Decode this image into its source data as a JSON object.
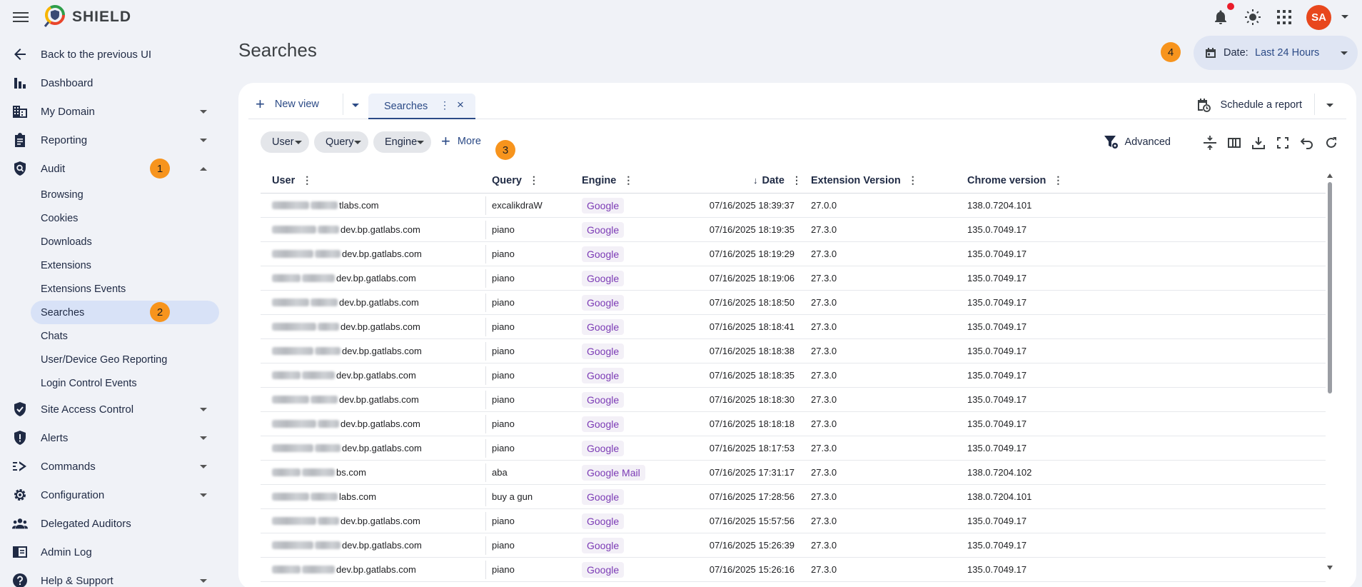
{
  "app": {
    "brand": "SHIELD"
  },
  "topbar": {
    "avatar_initials": "SA"
  },
  "sidebar": {
    "back": "Back to the previous UI",
    "items": [
      {
        "label": "Dashboard",
        "icon": "bar-chart-icon"
      },
      {
        "label": "My Domain",
        "icon": "domain-icon"
      },
      {
        "label": "Reporting",
        "icon": "clipboard-icon"
      },
      {
        "label": "Audit",
        "icon": "audit-shield-icon"
      },
      {
        "label": "Site Access Control",
        "icon": "site-access-icon"
      },
      {
        "label": "Alerts",
        "icon": "alert-shield-icon"
      },
      {
        "label": "Commands",
        "icon": "commands-icon"
      },
      {
        "label": "Configuration",
        "icon": "gear-icon"
      },
      {
        "label": "Delegated Auditors",
        "icon": "people-icon"
      },
      {
        "label": "Admin Log",
        "icon": "log-icon"
      },
      {
        "label": "Help & Support",
        "icon": "help-icon"
      }
    ],
    "audit_sub": [
      "Browsing",
      "Cookies",
      "Downloads",
      "Extensions",
      "Extensions Events",
      "Searches",
      "Chats",
      "User/Device Geo Reporting",
      "Login Control Events"
    ],
    "badges": {
      "audit": "1",
      "searches": "2"
    }
  },
  "main": {
    "title": "Searches",
    "badge_filters": "3",
    "badge_date": "4",
    "date": {
      "label": "Date:",
      "value": "Last 24 Hours"
    },
    "tabs": {
      "new_view": "New view",
      "active": "Searches"
    },
    "schedule": "Schedule a report",
    "filters": [
      "User",
      "Query",
      "Engine"
    ],
    "more": "More",
    "advanced": "Advanced"
  },
  "table": {
    "columns": [
      "User",
      "Query",
      "Engine",
      "Date",
      "Extension Version",
      "Chrome version"
    ],
    "rows": [
      {
        "user": "tlabs.com",
        "query": "excalikdraW",
        "engine": "Google",
        "date": "07/16/2025 18:39:37",
        "ext": "27.0.0",
        "chrome": "138.0.7204.101"
      },
      {
        "user": "dev.bp.gatlabs.com",
        "query": "piano",
        "engine": "Google",
        "date": "07/16/2025 18:19:35",
        "ext": "27.3.0",
        "chrome": "135.0.7049.17"
      },
      {
        "user": "dev.bp.gatlabs.com",
        "query": "piano",
        "engine": "Google",
        "date": "07/16/2025 18:19:29",
        "ext": "27.3.0",
        "chrome": "135.0.7049.17"
      },
      {
        "user": "dev.bp.gatlabs.com",
        "query": "piano",
        "engine": "Google",
        "date": "07/16/2025 18:19:06",
        "ext": "27.3.0",
        "chrome": "135.0.7049.17"
      },
      {
        "user": "dev.bp.gatlabs.com",
        "query": "piano",
        "engine": "Google",
        "date": "07/16/2025 18:18:50",
        "ext": "27.3.0",
        "chrome": "135.0.7049.17"
      },
      {
        "user": "dev.bp.gatlabs.com",
        "query": "piano",
        "engine": "Google",
        "date": "07/16/2025 18:18:41",
        "ext": "27.3.0",
        "chrome": "135.0.7049.17"
      },
      {
        "user": "dev.bp.gatlabs.com",
        "query": "piano",
        "engine": "Google",
        "date": "07/16/2025 18:18:38",
        "ext": "27.3.0",
        "chrome": "135.0.7049.17"
      },
      {
        "user": "dev.bp.gatlabs.com",
        "query": "piano",
        "engine": "Google",
        "date": "07/16/2025 18:18:35",
        "ext": "27.3.0",
        "chrome": "135.0.7049.17"
      },
      {
        "user": "dev.bp.gatlabs.com",
        "query": "piano",
        "engine": "Google",
        "date": "07/16/2025 18:18:30",
        "ext": "27.3.0",
        "chrome": "135.0.7049.17"
      },
      {
        "user": "dev.bp.gatlabs.com",
        "query": "piano",
        "engine": "Google",
        "date": "07/16/2025 18:18:18",
        "ext": "27.3.0",
        "chrome": "135.0.7049.17"
      },
      {
        "user": "dev.bp.gatlabs.com",
        "query": "piano",
        "engine": "Google",
        "date": "07/16/2025 18:17:53",
        "ext": "27.3.0",
        "chrome": "135.0.7049.17"
      },
      {
        "user": "bs.com",
        "query": "aba",
        "engine": "Google Mail",
        "date": "07/16/2025 17:31:17",
        "ext": "27.3.0",
        "chrome": "138.0.7204.102"
      },
      {
        "user": "labs.com",
        "query": "buy a gun",
        "engine": "Google",
        "date": "07/16/2025 17:28:56",
        "ext": "27.3.0",
        "chrome": "138.0.7204.101"
      },
      {
        "user": "dev.bp.gatlabs.com",
        "query": "piano",
        "engine": "Google",
        "date": "07/16/2025 15:57:56",
        "ext": "27.3.0",
        "chrome": "135.0.7049.17"
      },
      {
        "user": "dev.bp.gatlabs.com",
        "query": "piano",
        "engine": "Google",
        "date": "07/16/2025 15:26:39",
        "ext": "27.3.0",
        "chrome": "135.0.7049.17"
      },
      {
        "user": "dev.bp.gatlabs.com",
        "query": "piano",
        "engine": "Google",
        "date": "07/16/2025 15:26:16",
        "ext": "27.3.0",
        "chrome": "135.0.7049.17"
      }
    ]
  },
  "colors": {
    "accent": "#2b4a86",
    "badge": "#f7941d",
    "avatar": "#e8471d",
    "engine_text": "#7b3ab5",
    "active_nav": "#d8e2f7"
  }
}
